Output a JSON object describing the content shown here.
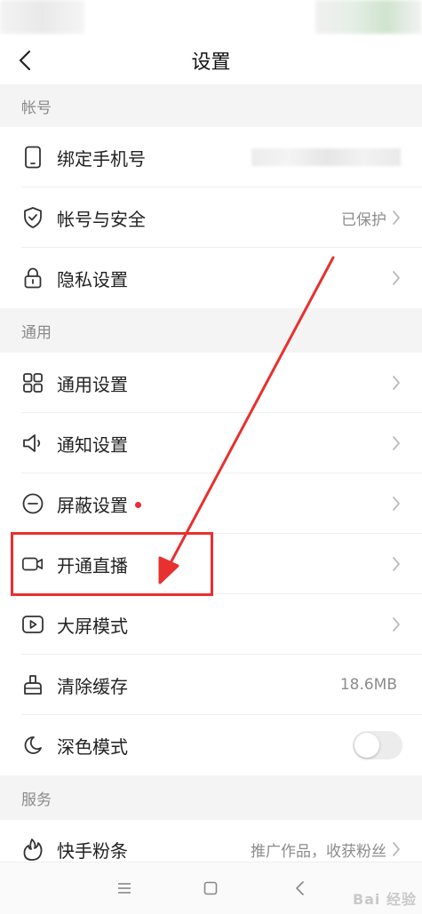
{
  "header": {
    "title": "设置"
  },
  "sections": {
    "account": "帐号",
    "general": "通用",
    "service": "服务"
  },
  "rows": {
    "bind_phone": {
      "label": "绑定手机号",
      "icon": "phone-icon"
    },
    "account_security": {
      "label": "帐号与安全",
      "value": "已保护",
      "icon": "shield-icon"
    },
    "privacy": {
      "label": "隐私设置",
      "icon": "lock-icon"
    },
    "general_settings": {
      "label": "通用设置",
      "icon": "grid-icon"
    },
    "notification": {
      "label": "通知设置",
      "icon": "speaker-icon"
    },
    "block": {
      "label": "屏蔽设置",
      "icon": "block-icon",
      "has_red_dot": true
    },
    "live": {
      "label": "开通直播",
      "icon": "video-camera-icon"
    },
    "big_screen": {
      "label": "大屏模式",
      "icon": "play-screen-icon"
    },
    "clear_cache": {
      "label": "清除缓存",
      "value": "18.6MB",
      "icon": "brush-icon"
    },
    "dark_mode": {
      "label": "深色模式",
      "icon": "moon-icon",
      "toggle_on": false
    },
    "fans": {
      "label": "快手粉条",
      "value": "推广作品，收获粉丝",
      "icon": "fire-icon"
    }
  },
  "watermark": "Bai 经验",
  "colors": {
    "accent_red": "#e8302f",
    "section_bg": "#f4f4f4",
    "value_gray": "#8c8c8c"
  }
}
